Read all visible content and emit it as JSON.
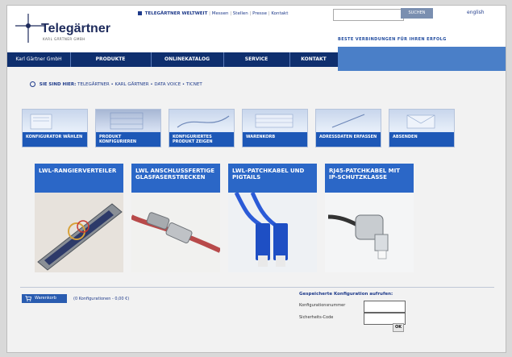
{
  "header": {
    "brand": "Telegärtner",
    "brand_sub": "KARL GÄRTNER GMBH",
    "toplinks": [
      "TELEGÄRTNER WELTWEIT",
      "Messen",
      "Stellen",
      "Presse",
      "Kontakt"
    ],
    "search_button": "SUCHEN",
    "search_placeholder": "",
    "language": "english",
    "tagline": "BESTE VERBINDUNGEN FÜR IHREN ERFOLG"
  },
  "nav": {
    "items": [
      "Karl Gärtner GmbH",
      "PRODUKTE",
      "ONLINEKATALOG",
      "SERVICE",
      "KONTAKT"
    ]
  },
  "breadcrumb": {
    "prefix": "SIE SIND HIER:",
    "path": "TELEGÄRTNER • KARL GÄRTNER • DATA VOICE • TICNET"
  },
  "steps": [
    {
      "label": "KONFIGURATOR WÄHLEN"
    },
    {
      "label": "PRODUKT KONFIGURIEREN"
    },
    {
      "label": "KONFIGURIERTES PRODUKT ZEIGEN"
    },
    {
      "label": "WARENKORB"
    },
    {
      "label": "ADRESSDATEN ERFASSEN"
    },
    {
      "label": "ABSENDEN"
    }
  ],
  "cards": [
    {
      "title": "LWL-RANGIERVERTEILER"
    },
    {
      "title": "LWL ANSCHLUSSFERTIGE GLASFASERSTRECKEN"
    },
    {
      "title": "LWL-PATCHKABEL UND PIGTAILS"
    },
    {
      "title": "RJ45-PATCHKABEL MIT IP-SCHUTZKLASSE"
    }
  ],
  "cart": {
    "button_label": "Warenkorb",
    "info": "(0 Konfigurationen - 0,00 €)"
  },
  "saved": {
    "title": "Gespeicherte Konfiguration aufrufen:",
    "field1_label": "Konfigurationsnummer",
    "field2_label": "Sicherheits-Code",
    "ok_label": "OK"
  },
  "colors": {
    "navy": "#0f2f6e",
    "accent_blue": "#2b67c7",
    "light_blue": "#4a7fc8"
  }
}
